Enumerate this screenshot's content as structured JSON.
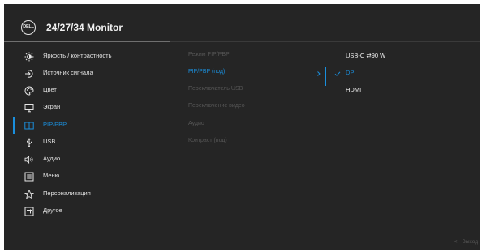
{
  "header": {
    "logo_text": "DELL",
    "title": "24/27/34 Monitor"
  },
  "menu": {
    "items": [
      {
        "label": "Яркость / контрастность",
        "icon": "brightness-icon"
      },
      {
        "label": "Источник сигнала",
        "icon": "input-source-icon"
      },
      {
        "label": "Цвет",
        "icon": "color-palette-icon"
      },
      {
        "label": "Экран",
        "icon": "display-icon"
      },
      {
        "label": "PIP/PBP",
        "icon": "pip-pbp-icon",
        "active": true
      },
      {
        "label": "USB",
        "icon": "usb-icon"
      },
      {
        "label": "Аудио",
        "icon": "speaker-icon"
      },
      {
        "label": "Меню",
        "icon": "menu-icon"
      },
      {
        "label": "Персонализация",
        "icon": "star-icon"
      },
      {
        "label": "Другое",
        "icon": "other-icon"
      }
    ]
  },
  "submenu": {
    "items": [
      {
        "label": "Режим PIP/PBP"
      },
      {
        "label": "PIP/PBP (под)",
        "active": true
      },
      {
        "label": "Переключатель USB"
      },
      {
        "label": "Переключение видео"
      },
      {
        "label": "Аудио"
      },
      {
        "label": "Контраст (под)"
      }
    ]
  },
  "options": {
    "items": [
      {
        "label": "USB-C ⇄90 W",
        "icon": "usb-c-pd-icon"
      },
      {
        "label": "DP",
        "selected": true
      },
      {
        "label": "HDMI"
      }
    ]
  },
  "footer": {
    "exit_label": "Выход"
  },
  "colors": {
    "accent": "#1a8fdd",
    "background": "#252525",
    "text": "#e0e0e0",
    "disabled_text": "#565656"
  }
}
